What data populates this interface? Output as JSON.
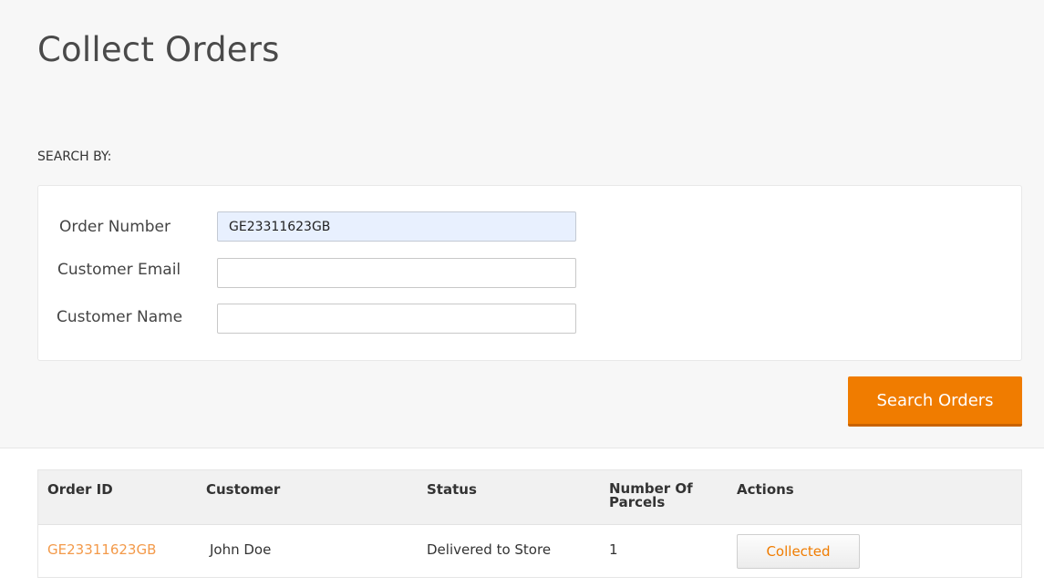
{
  "page": {
    "title": "Collect Orders"
  },
  "search": {
    "section_label": "SEARCH BY:",
    "fields": [
      {
        "label": "Order Number",
        "value": "GE23311623GB"
      },
      {
        "label": "Customer Email",
        "value": ""
      },
      {
        "label": "Customer Name",
        "value": ""
      }
    ],
    "button_label": "Search Orders"
  },
  "table": {
    "headers": [
      "Order ID",
      "Customer",
      "Status",
      "Number Of Parcels",
      "Actions"
    ],
    "rows": [
      {
        "order_id": "GE23311623GB",
        "customer": "John Doe",
        "status": "Delivered to Store",
        "parcels": "1",
        "action_label": "Collected"
      }
    ]
  },
  "colors": {
    "accent": "#f07c00",
    "link": "#f39a4a",
    "autofill": "#e8f0fe"
  }
}
